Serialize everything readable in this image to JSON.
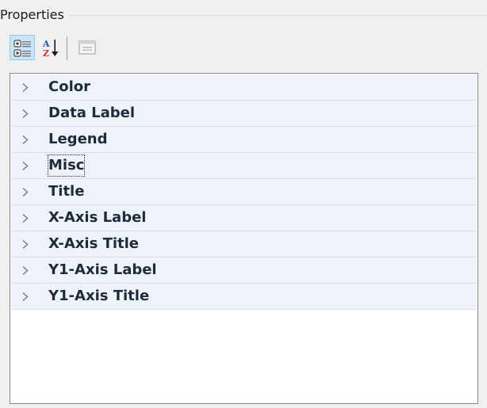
{
  "panel": {
    "title": "Properties"
  },
  "toolbar": {
    "buttons": [
      {
        "icon": "categorized-icon",
        "active": true
      },
      {
        "icon": "sort-alphabetical-icon",
        "active": false
      },
      {
        "icon": "property-pages-icon",
        "active": false,
        "disabled": true
      }
    ]
  },
  "grid": {
    "categories": [
      {
        "label": "Color"
      },
      {
        "label": "Data Label"
      },
      {
        "label": "Legend"
      },
      {
        "label": "Misc",
        "focused": true
      },
      {
        "label": "Title"
      },
      {
        "label": "X-Axis Label"
      },
      {
        "label": "X-Axis Title"
      },
      {
        "label": "Y1-Axis Label"
      },
      {
        "label": "Y1-Axis Title"
      }
    ]
  },
  "colors": {
    "category_row_bg": "#eef3fa",
    "active_button_bg": "#cce4f7",
    "grid_border": "#828790"
  }
}
